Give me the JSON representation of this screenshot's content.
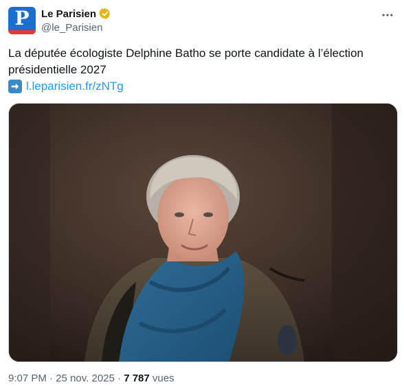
{
  "author": {
    "display_name": "Le Parisien",
    "handle": "@le_Parisien",
    "avatar_letter": "P",
    "verified_badge_color": "#e2b719"
  },
  "tweet": {
    "text": "La députée écologiste Delphine Batho se porte candidate à l’élection présidentielle 2027",
    "link_text": "l.leparisien.fr/zNTg",
    "link_icon": "right-arrow-emoji"
  },
  "meta": {
    "time": "9:07 PM",
    "separator": " · ",
    "date": "25 nov. 2025",
    "views_count": "7 787",
    "views_label": "vues"
  },
  "colors": {
    "link": "#1d9bf0",
    "secondary_text": "#536471",
    "brand_blue": "#1b6fcf",
    "brand_red": "#e53935"
  }
}
